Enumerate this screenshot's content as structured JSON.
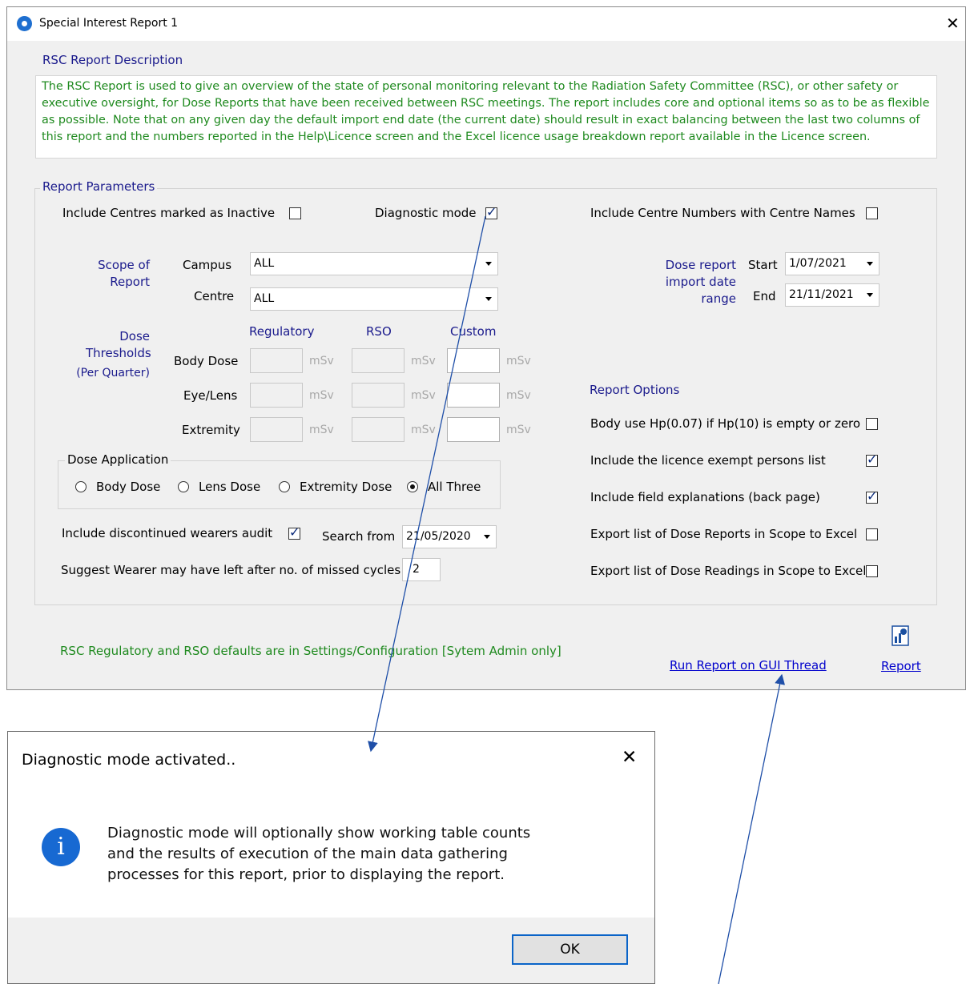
{
  "window": {
    "title": "Special Interest Report 1",
    "description_heading": "RSC Report Description",
    "description_text": "The RSC Report is used to give an overview of the state of personal monitoring relevant to the Radiation Safety Committee (RSC), or other safety or executive oversight, for Dose Reports that have been received between RSC meetings. The report includes core and optional items so as to be as flexible as possible. Note that on any given day the default import end date (the current date) should result in exact balancing between the last two columns of this report and the numbers reported in the Help\\Licence screen and the Excel licence usage breakdown report available in the Licence screen."
  },
  "params": {
    "group_title": "Report Parameters",
    "include_inactive": {
      "label": "Include Centres marked as Inactive",
      "checked": false
    },
    "diagnostic_mode": {
      "label": "Diagnostic mode",
      "checked": true
    },
    "include_centre_numbers": {
      "label": "Include Centre Numbers with Centre Names",
      "checked": false
    },
    "scope_label": [
      "Scope of",
      "Report"
    ],
    "campus": {
      "label": "Campus",
      "value": "ALL"
    },
    "centre": {
      "label": "Centre",
      "value": "ALL"
    },
    "date_range_label": [
      "Dose report",
      "import date",
      "range"
    ],
    "start": {
      "label": "Start",
      "value": "1/07/2021"
    },
    "end": {
      "label": "End",
      "value": "21/11/2021"
    },
    "thresholds_label": [
      "Dose",
      "Thresholds",
      "(Per Quarter)"
    ],
    "threshold_cols": [
      "Regulatory",
      "RSO",
      "Custom"
    ],
    "threshold_rows": [
      "Body Dose",
      "Eye/Lens",
      "Extremity"
    ],
    "unit": "mSv",
    "dose_application": {
      "title": "Dose Application",
      "options": [
        "Body Dose",
        "Lens Dose",
        "Extremity Dose",
        "All Three"
      ],
      "selected": "All Three"
    },
    "discontinued_audit": {
      "label": "Include discontinued wearers audit",
      "checked": true
    },
    "search_from": {
      "label": "Search from",
      "value": "21/05/2020"
    },
    "missed_cycles": {
      "label": "Suggest Wearer may have left after no. of missed cycles :",
      "value": "2"
    }
  },
  "options": {
    "title": "Report Options",
    "items": [
      {
        "label": "Body use Hp(0.07) if Hp(10) is empty or zero",
        "checked": false
      },
      {
        "label": "Include the licence exempt persons list",
        "checked": true
      },
      {
        "label": "Include field explanations (back page)",
        "checked": true
      },
      {
        "label": "Export list of Dose Reports in Scope to Excel",
        "checked": false
      },
      {
        "label": "Export list of Dose Readings in Scope to Excel",
        "checked": false
      }
    ]
  },
  "footer": {
    "defaults_note": "RSC Regulatory and RSO defaults are in Settings/Configuration [Sytem Admin only]",
    "run_gui_link": "Run Report on GUI Thread",
    "report_link": "Report"
  },
  "dialog": {
    "title": "Diagnostic mode activated..",
    "message": [
      "Diagnostic mode will optionally show working table counts",
      "and the results of execution of the main data gathering",
      "processes for this report, prior to displaying the report."
    ],
    "ok_label": "OK"
  },
  "colors": {
    "accent": "#1a1a8c",
    "green_text": "#1f8a1f",
    "link": "#0000cc",
    "arrow": "#1f4fa8"
  }
}
